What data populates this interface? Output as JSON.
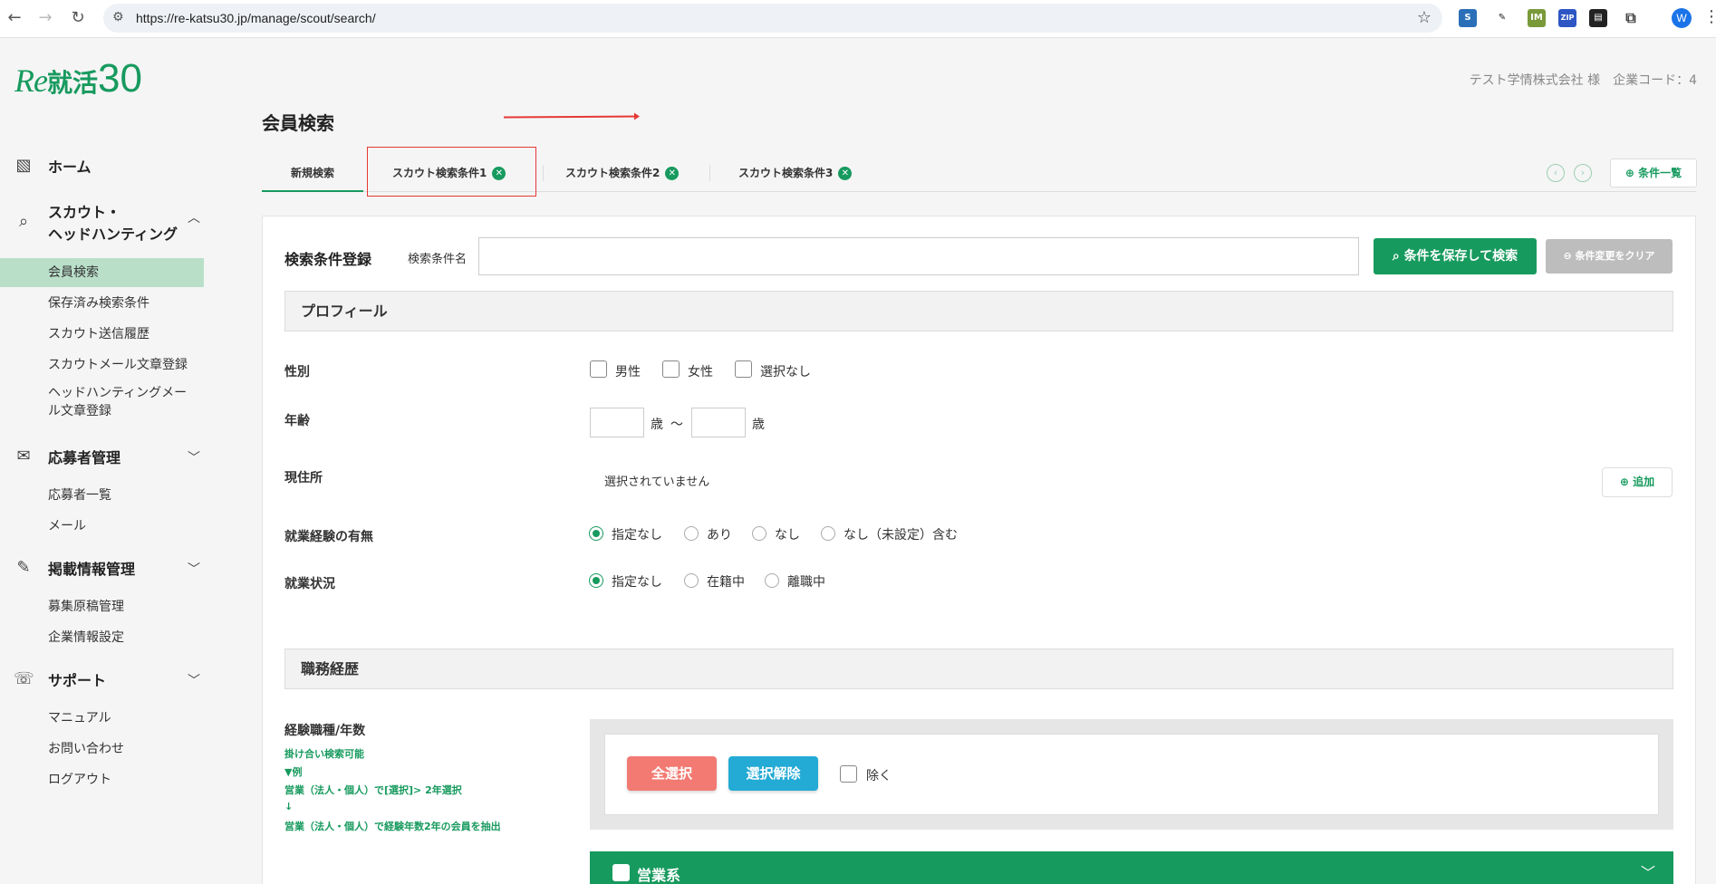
{
  "browser": {
    "url": "https://re-katsu30.jp/manage/scout/search/",
    "profile_initial": "W",
    "extensions": [
      "screen-icon",
      "eyedropper-icon",
      "im-icon",
      "zip-icon",
      "document-icon",
      "puzzle-icon"
    ]
  },
  "brand": {
    "logo_re": "Re",
    "logo_katsu": "就活",
    "logo_30": "30",
    "color": "#179a5e"
  },
  "header": {
    "company": "テスト学情株式会社 様　企業コード：4",
    "page_title": "会員検索"
  },
  "sidebar": {
    "home": "ホーム",
    "scout_title": "スカウト・\nヘッドハンティング",
    "scout_items": [
      "会員検索",
      "保存済み検索条件",
      "スカウト送信履歴",
      "スカウトメール文章登録",
      "ヘッドハンティングメー\nル文章登録"
    ],
    "applicant_title": "応募者管理",
    "applicant_items": [
      "応募者一覧",
      "メール"
    ],
    "listing_title": "掲載情報管理",
    "listing_items": [
      "募集原稿管理",
      "企業情報設定"
    ],
    "support_title": "サポート",
    "support_items": [
      "マニュアル",
      "お問い合わせ",
      "ログアウト"
    ]
  },
  "tabs": [
    "新規検索",
    "スカウト検索条件1",
    "スカウト検索条件2",
    "スカウト検索条件3"
  ],
  "tab_list_button": "条件一覧",
  "search_reg": {
    "title": "検索条件登録",
    "name_label": "検索条件名",
    "save_button": "条件を保存して検索",
    "clear_button": "条件変更をクリア"
  },
  "profile": {
    "title": "プロフィール",
    "gender_label": "性別",
    "gender_options": [
      "男性",
      "女性",
      "選択なし"
    ],
    "age_label": "年齢",
    "age_unit": "歳",
    "age_sep": "〜",
    "address_label": "現住所",
    "address_value": "選択されていません",
    "add_button": "追加",
    "experience_label": "就業経験の有無",
    "experience_options": [
      "指定なし",
      "あり",
      "なし",
      "なし（未設定）含む"
    ],
    "status_label": "就業状況",
    "status_options": [
      "指定なし",
      "在籍中",
      "離職中"
    ]
  },
  "career": {
    "title": "職務経歴",
    "job_label": "経験職種/年数",
    "notes": [
      "掛け合い検索可能",
      "▼例",
      "営業（法人・個人）で[選択]> 2年選択",
      "↓",
      "営業（法人・個人）で経験年数2年の会員を抽出"
    ],
    "select_all": "全選択",
    "deselect": "選択解除",
    "exclude": "除く",
    "category": "営業系"
  }
}
